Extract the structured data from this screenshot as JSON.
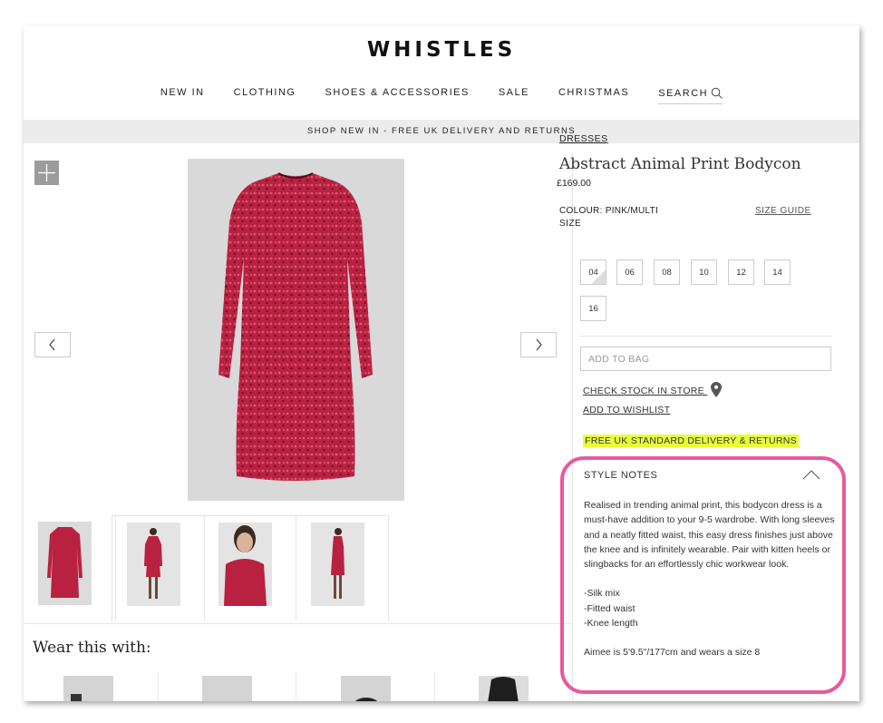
{
  "brand": "WHISTLES",
  "nav": {
    "items": [
      "NEW IN",
      "CLOTHING",
      "SHOES & ACCESSORIES",
      "SALE",
      "CHRISTMAS"
    ],
    "search_label": "SEARCH"
  },
  "promo_banner": "SHOP NEW IN - FREE UK DELIVERY AND RETURNS",
  "product": {
    "breadcrumb": "DRESSES",
    "name": "Abstract Animal Print Bodycon",
    "price": "£169.00",
    "colour_label": "COLOUR: PINK/MULTI",
    "size_guide": "SIZE GUIDE",
    "size_label": "SIZE",
    "sizes": [
      "04",
      "06",
      "08",
      "10",
      "12",
      "14",
      "16"
    ],
    "add_to_bag": "ADD TO BAG",
    "check_stock": "CHECK STOCK IN STORE",
    "add_to_wishlist": "ADD TO WISHLIST",
    "delivery_note": "FREE UK STANDARD DELIVERY & RETURNS",
    "style_notes": {
      "title": "STYLE NOTES",
      "description": "Realised in trending animal print, this bodycon dress is a must-have addition to your 9-5 wardrobe. With long sleeves and a neatly fitted waist, this easy dress finishes just above the knee and is infinitely wearable. Pair with kitten heels or slingbacks for an effortlessly chic workwear look.",
      "bullets": [
        "-Silk mix",
        "-Fitted waist",
        "-Knee length"
      ],
      "model_info": "Aimee is 5'9.5\"/177cm and wears a size 8"
    }
  },
  "gallery": {
    "thumbnail_count": 4
  },
  "wear_this_with": {
    "title": "Wear this with:"
  },
  "colors": {
    "dress_red": "#c8284a",
    "highlight_yellow": "#e8ff3a",
    "annotation_pink": "#e75a9e",
    "promo_bg": "#ececec"
  }
}
